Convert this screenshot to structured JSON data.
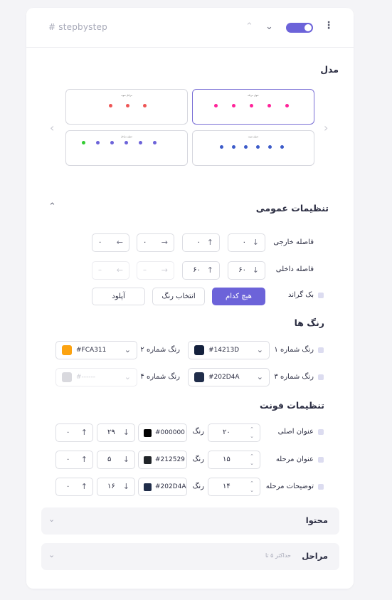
{
  "header": {
    "title": "# stepbystep",
    "toggle_on": true
  },
  "model": {
    "label": "مدل",
    "thumb_titles": [
      "مراحل نمونه",
      "عنوان مرحله",
      "عنوان مراحل",
      "عنوان نمونه"
    ]
  },
  "general": {
    "title": "تنظیمات عمومی",
    "margin": {
      "label": "فاصله خارجی",
      "values": [
        "۰",
        "۰",
        "۰",
        "۰"
      ]
    },
    "padding": {
      "label": "فاصله داخلی",
      "values": [
        "۶۰",
        "۶۰",
        "–",
        "–"
      ]
    },
    "background": {
      "label": "بک گراند",
      "options": [
        "هیچ کدام",
        "انتخاب رنگ",
        "آپلود"
      ],
      "selected": "هیچ کدام"
    }
  },
  "colors": {
    "title": "رنگ ها",
    "items": [
      {
        "label": "رنگ شماره ۱",
        "hex": "#14213D",
        "swatch": "#14213D"
      },
      {
        "label": "رنگ شماره ۲",
        "hex": "#FCA311",
        "swatch": "#FCA311"
      },
      {
        "label": "رنگ شماره ۳",
        "hex": "#202D4A",
        "swatch": "#202D4A"
      },
      {
        "label": "رنگ شماره ۴",
        "hex": "#------",
        "swatch": "#d9d9de"
      }
    ]
  },
  "fonts": {
    "title": "تنظیمات فونت",
    "color_label": "رنگ",
    "rows": [
      {
        "label": "عنوان اصلی",
        "size": "۲۰",
        "hex": "#000000",
        "swatch": "#000000",
        "weight": "۲۹",
        "spacing": "۰"
      },
      {
        "label": "عنوان مرحله",
        "size": "۱۵",
        "hex": "#212529",
        "swatch": "#212529",
        "weight": "۵",
        "spacing": "۰"
      },
      {
        "label": "توضیحات مرحله",
        "size": "۱۴",
        "hex": "#202D4A",
        "swatch": "#202D4A",
        "weight": "۱۶",
        "spacing": "۰"
      }
    ]
  },
  "sections": {
    "content": {
      "title": "محتوا"
    },
    "steps": {
      "title": "مراحل",
      "hint": "حداکثر ۵ تا"
    }
  },
  "colors_accent": {
    "primary": "#6c63d9",
    "checkbox": "#dcdcf0"
  }
}
